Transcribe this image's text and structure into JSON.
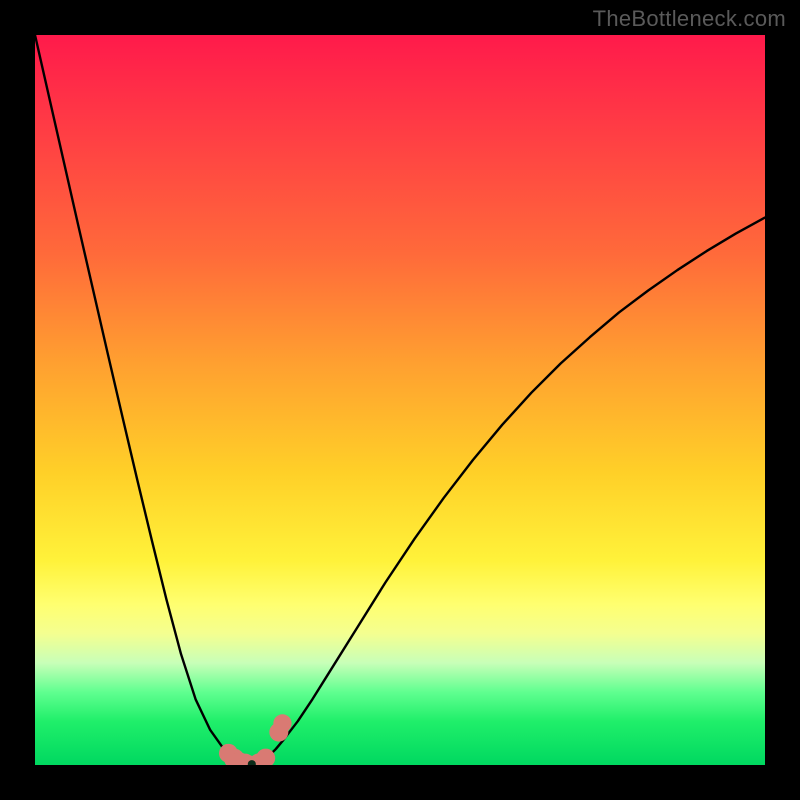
{
  "watermark": "TheBottleneck.com",
  "colors": {
    "background": "#000000",
    "curve": "#000000",
    "markers": "#d97a73",
    "min_marker_outline": "#0a2a18",
    "gradient_stops": [
      "#ff1a4b",
      "#ff3a45",
      "#ff6a3a",
      "#ffa030",
      "#ffd028",
      "#fff23a",
      "#ffff70",
      "#f4ff90",
      "#c8ffb8",
      "#60ff90",
      "#20ef6a",
      "#00d860"
    ]
  },
  "chart_data": {
    "type": "line",
    "title": "",
    "xlabel": "",
    "ylabel": "",
    "xlim": [
      0,
      100
    ],
    "ylim": [
      0,
      100
    ],
    "x": [
      0,
      2,
      4,
      6,
      8,
      10,
      12,
      14,
      16,
      18,
      20,
      22,
      24,
      26,
      27,
      28,
      29,
      29.7,
      30.5,
      31.2,
      32,
      33,
      34,
      36,
      38,
      40,
      44,
      48,
      52,
      56,
      60,
      64,
      68,
      72,
      76,
      80,
      84,
      88,
      92,
      96,
      100
    ],
    "values": [
      100,
      91.2,
      82.4,
      73.6,
      64.9,
      56.2,
      47.6,
      39.1,
      30.8,
      22.7,
      15.2,
      9.0,
      4.8,
      2.0,
      1.0,
      0.4,
      0.2,
      0.1,
      0.2,
      0.6,
      1.2,
      2.2,
      3.4,
      6.0,
      9.0,
      12.2,
      18.6,
      25.0,
      31.0,
      36.6,
      41.8,
      46.6,
      51.0,
      55.0,
      58.6,
      62.0,
      65.0,
      67.8,
      70.4,
      72.8,
      75.0
    ],
    "minimum_x": 29.7,
    "markers": [
      {
        "x": 26.5,
        "y": 1.6,
        "r": 1.3
      },
      {
        "x": 27.3,
        "y": 0.85,
        "r": 1.4
      },
      {
        "x": 28.0,
        "y": 0.45,
        "r": 1.3
      },
      {
        "x": 28.8,
        "y": 0.25,
        "r": 1.3
      },
      {
        "x": 29.7,
        "y": 0.12,
        "r": 1.15
      },
      {
        "x": 30.7,
        "y": 0.3,
        "r": 1.3
      },
      {
        "x": 31.6,
        "y": 0.95,
        "r": 1.3
      },
      {
        "x": 33.4,
        "y": 4.5,
        "r": 1.3
      },
      {
        "x": 33.9,
        "y": 5.7,
        "r": 1.25
      }
    ],
    "min_marker": {
      "x": 29.7,
      "y": 0.12,
      "r": 0.55
    }
  }
}
